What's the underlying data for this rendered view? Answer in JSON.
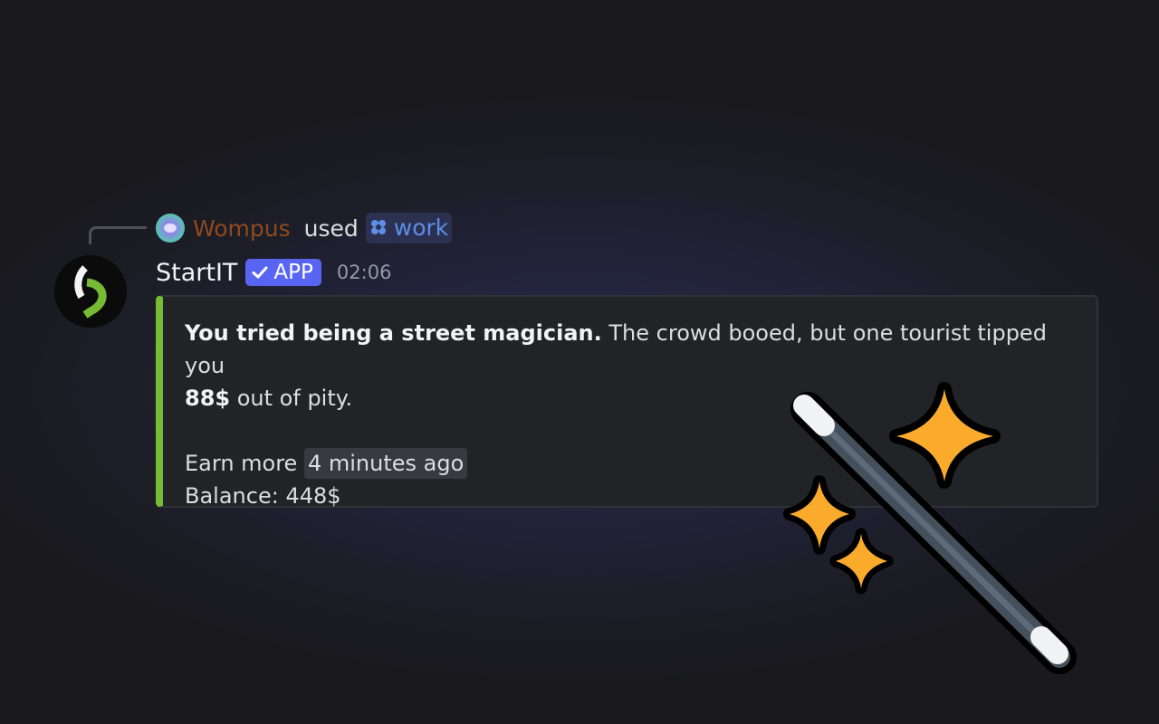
{
  "reply": {
    "username": "Wompus",
    "used_text": "used",
    "command": "work",
    "username_color": "#8e4a1e",
    "command_color": "#5d8ee8"
  },
  "message": {
    "bot_name": "StartIT",
    "badge_label": "APP",
    "timestamp": "02:06",
    "badge_color": "#5865f2",
    "embed_accent_color": "#77bb35"
  },
  "embed": {
    "bold_text": "You tried being a street magician.",
    "text_before_amount": "The crowd booed, but one tourist tipped you",
    "amount": "88$",
    "text_after_amount": "out of pity.",
    "earn_label": "Earn more",
    "earn_time": "4 minutes ago",
    "balance_label": "Balance:",
    "balance_value": "448$"
  },
  "icons": {
    "reply_avatar": "user-avatar-icon",
    "command": "slash-command-icon",
    "badge": "verified-check-icon",
    "bot_avatar": "startit-logo-icon",
    "decoration": "magic-wand-sparkles-icon"
  },
  "colors": {
    "background": "#1a1b20",
    "embed_background": "#222327",
    "sparkle": "#fbab2b"
  }
}
